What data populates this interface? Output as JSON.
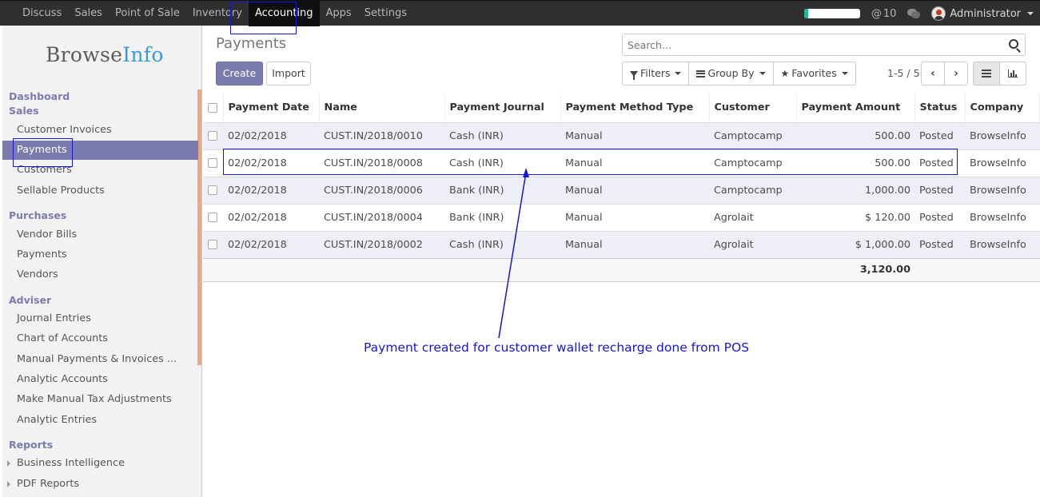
{
  "topbar": {
    "menu": [
      "Discuss",
      "Sales",
      "Point of Sale",
      "Inventory",
      "Accounting",
      "Apps",
      "Settings"
    ],
    "active_index": 4,
    "progress_percent": 8,
    "mentions": "10",
    "user_name": "Administrator"
  },
  "sidebar": {
    "logo_part1": "Browse",
    "logo_part2": "Info",
    "dashboard": "Dashboard",
    "sales_header": "Sales",
    "sales_items": [
      "Customer Invoices",
      "Payments",
      "Customers",
      "Sellable Products"
    ],
    "purchases_header": "Purchases",
    "purchases_items": [
      "Vendor Bills",
      "Payments",
      "Vendors"
    ],
    "adviser_header": "Adviser",
    "adviser_items": [
      "Journal Entries",
      "Chart of Accounts",
      "Manual Payments & Invoices ...",
      "Analytic Accounts",
      "Make Manual Tax Adjustments",
      "Analytic Entries"
    ],
    "reports_header": "Reports",
    "reports_items": [
      "Business Intelligence",
      "PDF Reports"
    ]
  },
  "main": {
    "title": "Payments",
    "create_label": "Create",
    "import_label": "Import",
    "search_placeholder": "Search...",
    "filters_label": "Filters",
    "groupby_label": "Group By",
    "favorites_label": "Favorites",
    "pager": "1-5 / 5"
  },
  "table": {
    "columns": [
      "Payment Date",
      "Name",
      "Payment Journal",
      "Payment Method Type",
      "Customer",
      "Payment Amount",
      "Status",
      "Company"
    ],
    "rows": [
      [
        "02/02/2018",
        "CUST.IN/2018/0010",
        "Cash (INR)",
        "Manual",
        "Camptocamp",
        "500.00",
        "Posted",
        "BrowseInfo"
      ],
      [
        "02/02/2018",
        "CUST.IN/2018/0008",
        "Cash (INR)",
        "Manual",
        "Camptocamp",
        "500.00",
        "Posted",
        "BrowseInfo"
      ],
      [
        "02/02/2018",
        "CUST.IN/2018/0006",
        "Bank (INR)",
        "Manual",
        "Camptocamp",
        "1,000.00",
        "Posted",
        "BrowseInfo"
      ],
      [
        "02/02/2018",
        "CUST.IN/2018/0004",
        "Bank (INR)",
        "Manual",
        "Agrolait",
        "$ 120.00",
        "Posted",
        "BrowseInfo"
      ],
      [
        "02/02/2018",
        "CUST.IN/2018/0002",
        "Cash (INR)",
        "Manual",
        "Agrolait",
        "$ 1,000.00",
        "Posted",
        "BrowseInfo"
      ]
    ],
    "total_amount": "3,120.00"
  },
  "annotation": {
    "text": "Payment created for customer wallet recharge done from POS",
    "color": "#1717d6"
  }
}
